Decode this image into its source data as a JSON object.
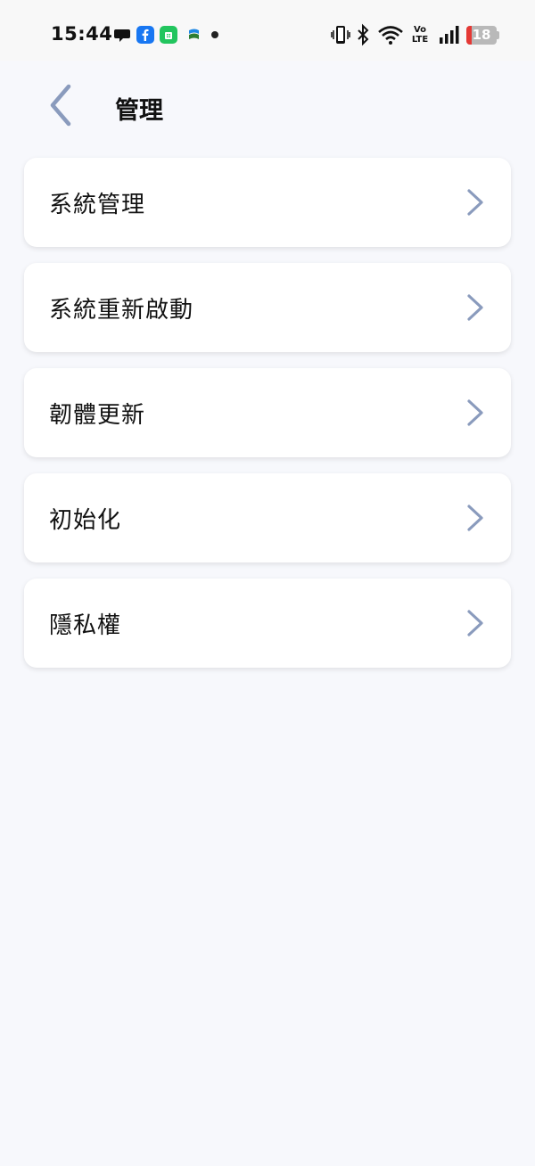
{
  "status_bar": {
    "time": "15:44",
    "battery_level": "18",
    "battery_fraction": 0.18,
    "network_label_top": "Vo",
    "network_label_bottom": "LTE",
    "icons": [
      "chat-bubble-icon",
      "facebook-icon",
      "line-app-icon",
      "flag-app-icon",
      "notification-dot-icon",
      "vibrate-icon",
      "bluetooth-icon",
      "wifi-icon",
      "volte-icon",
      "signal-icon",
      "battery-icon"
    ]
  },
  "header": {
    "back_icon": "chevron-left-icon",
    "title": "管理"
  },
  "menu": {
    "items": [
      {
        "label": "系統管理",
        "icon": "chevron-right-icon"
      },
      {
        "label": "系統重新啟動",
        "icon": "chevron-right-icon"
      },
      {
        "label": "韌體更新",
        "icon": "chevron-right-icon"
      },
      {
        "label": "初始化",
        "icon": "chevron-right-icon"
      },
      {
        "label": "隱私權",
        "icon": "chevron-right-icon"
      }
    ]
  },
  "colors": {
    "background": "#f7f8fc",
    "card": "#ffffff",
    "chevron": "#8a9bbd",
    "text": "#111111",
    "battery_low": "#e53935"
  }
}
